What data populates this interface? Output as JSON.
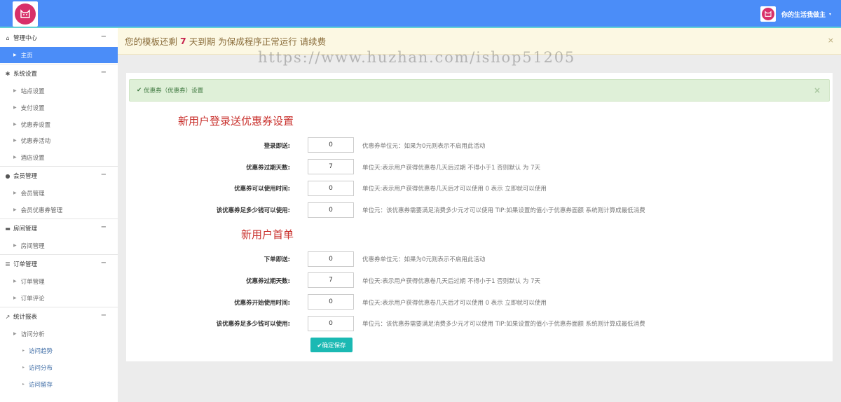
{
  "header": {
    "username": "你的生活我做主",
    "caret": "▾",
    "brand_color": "#4b8df8",
    "logo_icon": "cat-face-icon"
  },
  "sidebar": {
    "groups": [
      {
        "icon": "home-icon",
        "glyph": "⌂",
        "label": "管理中心",
        "toggle": "−",
        "items": [
          {
            "label": "主页",
            "active": true
          }
        ]
      },
      {
        "icon": "gear-icon",
        "glyph": "✱",
        "label": "系统设置",
        "toggle": "−",
        "items": [
          {
            "label": "站点设置"
          },
          {
            "label": "支付设置"
          },
          {
            "label": "优惠券设置"
          },
          {
            "label": "优惠券活动"
          },
          {
            "label": "酒店设置"
          }
        ]
      },
      {
        "icon": "user-icon",
        "glyph": "●",
        "label": "会员管理",
        "toggle": "−",
        "items": [
          {
            "label": "会员管理"
          },
          {
            "label": "会员优惠券管理"
          }
        ]
      },
      {
        "icon": "bed-icon",
        "glyph": "▬",
        "label": "房间管理",
        "toggle": "−",
        "items": [
          {
            "label": "房间管理"
          }
        ]
      },
      {
        "icon": "list-icon",
        "glyph": "☰",
        "label": "订单管理",
        "toggle": "−",
        "items": [
          {
            "label": "订单管理"
          },
          {
            "label": "订单评论"
          }
        ]
      },
      {
        "icon": "chart-line-icon",
        "glyph": "↗",
        "label": "统计报表",
        "toggle": "−",
        "items": [
          {
            "label": "访问分析"
          }
        ],
        "subitems": [
          {
            "label": "访问趋势"
          },
          {
            "label": "访问分布"
          },
          {
            "label": "访问留存"
          }
        ]
      }
    ]
  },
  "notice": {
    "prefix": "您的模板还剩",
    "days": "7",
    "suffix": "天到期 为保成程序正常运行 请续费",
    "close": "×"
  },
  "watermark": "https://www.huzhan.com/ishop51205",
  "panel": {
    "alert": {
      "check": "✔",
      "text": "优惠券（优惠券）设置",
      "close": "×"
    },
    "sections": [
      {
        "title": "新用户登录送优惠券设置",
        "fields": [
          {
            "label": "登录即送:",
            "value": "0",
            "help": "优惠券单位元：如果为0元则表示不启用此活动"
          },
          {
            "label": "优惠券过期天数:",
            "value": "7",
            "help": "单位天:表示用户获得优惠卷几天后过期 不得小于1 否则默认 为 7天"
          },
          {
            "label": "优惠券可以使用时间:",
            "value": "0",
            "help": "单位天:表示用户获得优惠卷几天后才可以使用 0 表示 立即就可以使用"
          },
          {
            "label": "该优惠券足多少钱可以使用:",
            "value": "0",
            "help": "单位元：该优惠券需要满足消费多少元才可以使用 TIP:如果设置的值小于优惠券面额 系统则计算成最低消费"
          }
        ]
      },
      {
        "title": "新用户首单",
        "fields": [
          {
            "label": "下单即送:",
            "value": "0",
            "help": "优惠券单位元：如果为0元则表示不启用此活动"
          },
          {
            "label": "优惠券过期天数:",
            "value": "7",
            "help": "单位天:表示用户获得优惠卷几天后过期 不得小于1 否则默认 为 7天"
          },
          {
            "label": "优惠券开始使用时间:",
            "value": "0",
            "help": "单位天:表示用户获得优惠卷几天后才可以使用 0 表示 立即就可以使用"
          },
          {
            "label": "该优惠券足多少钱可以使用:",
            "value": "0",
            "help": "单位元：该优惠券需要满足消费多少元才可以使用 TIP:如果设置的值小于优惠券面额 系统则计算成最低消费"
          }
        ]
      }
    ],
    "save_check": "✔",
    "save_label": "确定保存"
  }
}
